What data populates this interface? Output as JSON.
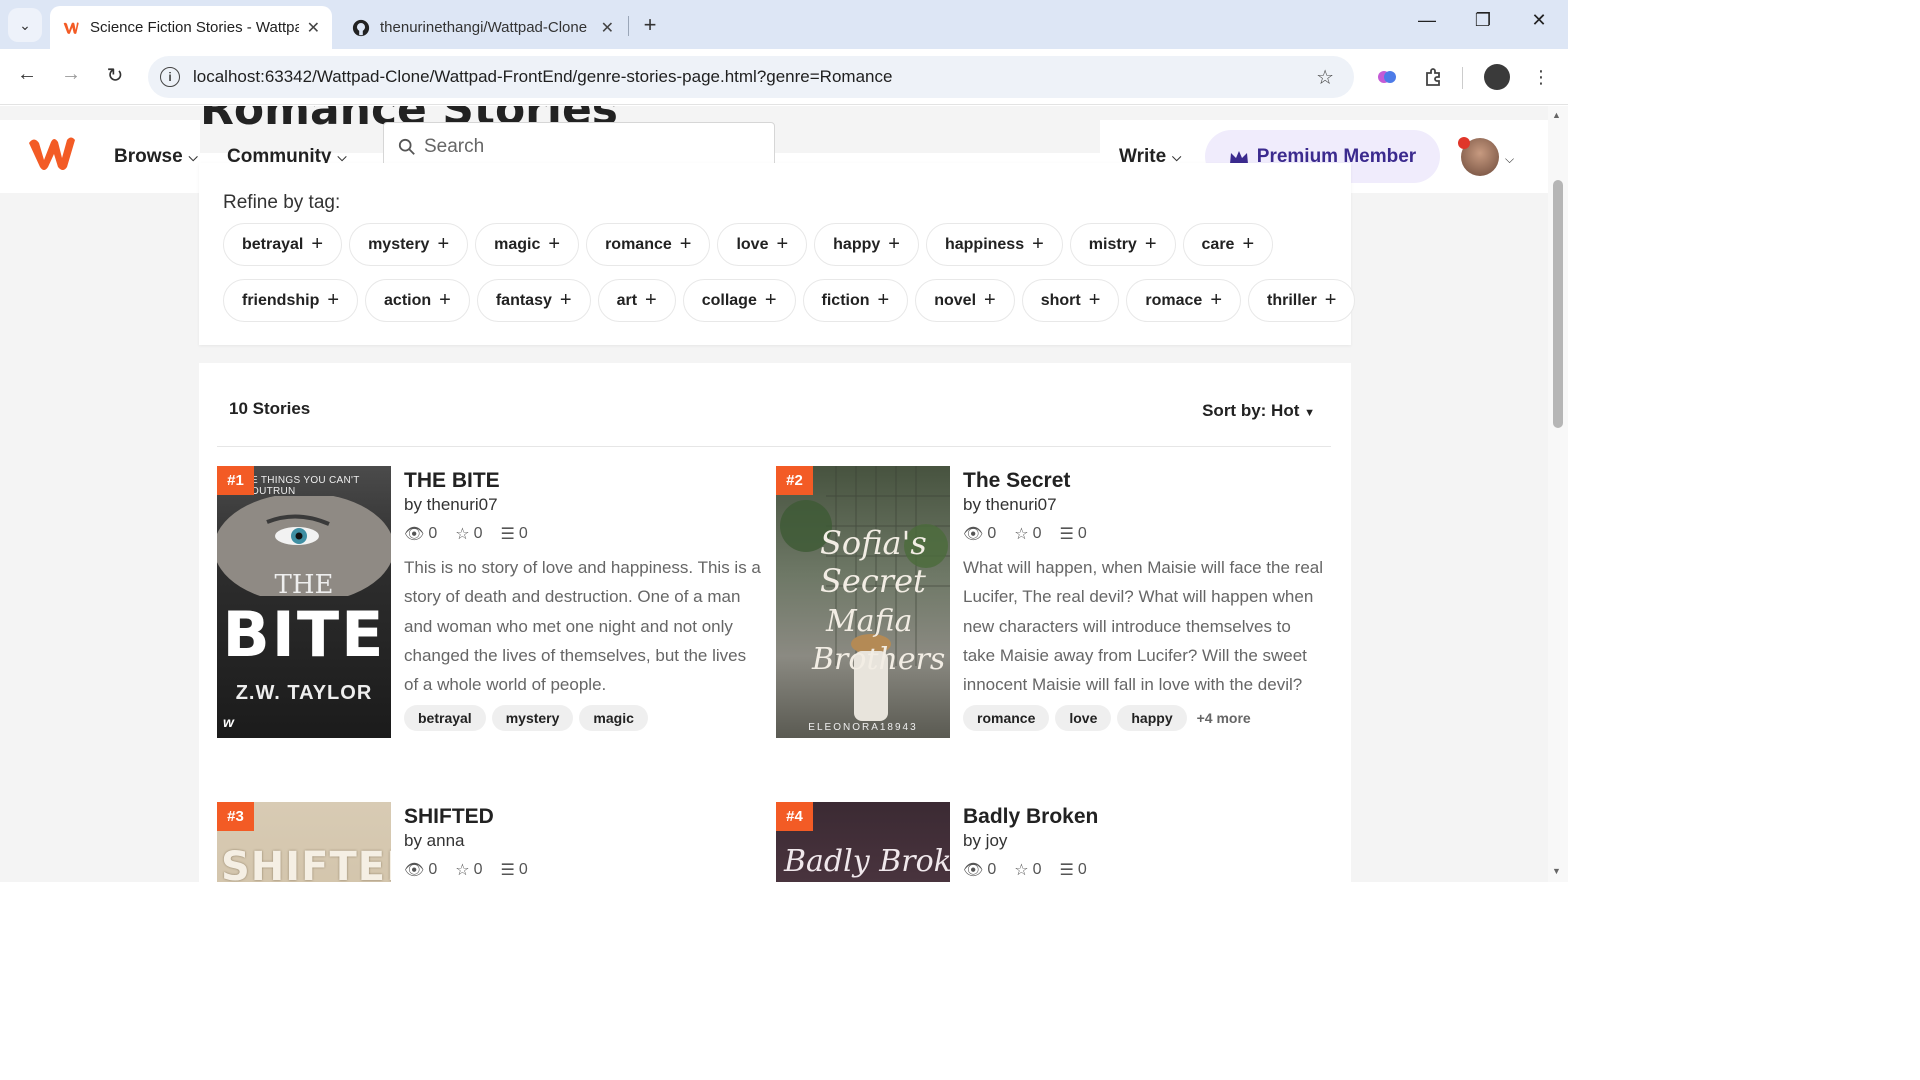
{
  "browser": {
    "tabs": [
      {
        "title": "Science Fiction Stories - Wattpa",
        "favicon": "wattpad-icon",
        "active": true
      },
      {
        "title": "thenurinethangi/Wattpad-Clone",
        "favicon": "github-icon",
        "active": false
      }
    ],
    "url": "localhost:63342/Wattpad-Clone/Wattpad-FrontEnd/genre-stories-page.html?genre=Romance"
  },
  "header": {
    "page_heading_behind": "Romance Stories",
    "nav": {
      "browse": "Browse",
      "community": "Community",
      "write": "Write"
    },
    "search_placeholder": "Search",
    "premium_label": "Premium Member"
  },
  "refine": {
    "label": "Refine by tag:",
    "row1": [
      "betrayal",
      "mystery",
      "magic",
      "romance",
      "love",
      "happy",
      "happiness",
      "mistry",
      "care"
    ],
    "row2": [
      "friendship",
      "action",
      "fantasy",
      "art",
      "collage",
      "fiction",
      "novel",
      "short",
      "romace",
      "thriller"
    ]
  },
  "stories_panel": {
    "count_label": "10 Stories",
    "sort_label": "Sort by: Hot"
  },
  "stories": [
    {
      "rank": "#1",
      "title": "THE BITE",
      "author": "by thenuri07",
      "views": "0",
      "votes": "0",
      "parts": "0",
      "description": "This is no story of love and happiness. This is a story of death and destruction. One of a man and woman who met one night and not only changed the lives of themselves, but the lives of a whole world of people.",
      "tags": [
        "betrayal",
        "mystery",
        "magic"
      ],
      "more": "",
      "cover_lines": [
        "E THINGS YOU CAN'T OUTRUN",
        "THE",
        "BITE",
        "Z.W. TAYLOR",
        "w"
      ]
    },
    {
      "rank": "#2",
      "title": "The Secret",
      "author": "by thenuri07",
      "views": "0",
      "votes": "0",
      "parts": "0",
      "description": "What will happen, when Maisie will face the real Lucifer, The real devil? What will happen when new characters will introduce themselves to take Maisie away from Lucifer? Will the sweet innocent Maisie will fall in love with the devil?",
      "tags": [
        "romance",
        "love",
        "happy"
      ],
      "more": "+4 more",
      "cover_lines": [
        "Sofia's",
        "Secret",
        "Mafia",
        "Brothers",
        "ELEONORA18943"
      ]
    },
    {
      "rank": "#3",
      "title": "SHIFTED",
      "author": "by anna",
      "views": "0",
      "votes": "0",
      "parts": "0",
      "description": "",
      "tags": [],
      "more": "",
      "cover_lines": [
        "SHIFTED"
      ]
    },
    {
      "rank": "#4",
      "title": "Badly Broken",
      "author": "by joy",
      "views": "0",
      "votes": "0",
      "parts": "0",
      "description": "",
      "tags": [],
      "more": "",
      "cover_lines": [
        "Badly Broken"
      ]
    }
  ],
  "colors": {
    "brand": "#f35b25",
    "premium_text": "#3b2a8e",
    "premium_bg": "#f0ecfc"
  }
}
